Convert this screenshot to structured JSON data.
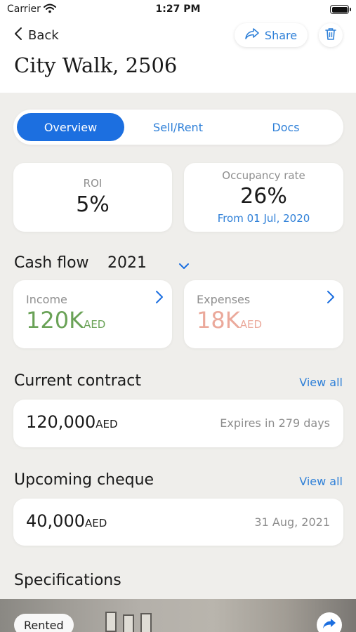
{
  "status_bar": {
    "carrier": "Carrier",
    "time": "1:27 PM"
  },
  "nav": {
    "back_label": "Back",
    "share_label": "Share"
  },
  "property": {
    "title": "City Walk, 2506"
  },
  "tabs": [
    {
      "label": "Overview",
      "active": true
    },
    {
      "label": "Sell/Rent",
      "active": false
    },
    {
      "label": "Docs",
      "active": false
    }
  ],
  "stats": {
    "roi": {
      "label": "ROI",
      "value": "5%"
    },
    "occupancy": {
      "label": "Occupancy rate",
      "value": "26%",
      "since": "From 01 Jul, 2020"
    }
  },
  "cash_flow": {
    "title": "Cash flow",
    "year": "2021",
    "income": {
      "label": "Income",
      "value": "120K",
      "unit": "AED"
    },
    "expenses": {
      "label": "Expenses",
      "value": "18K",
      "unit": "AED"
    }
  },
  "current_contract": {
    "title": "Current contract",
    "view_all": "View all",
    "amount": "120,000",
    "unit": "AED",
    "expiry": "Expires in 279 days"
  },
  "upcoming_cheque": {
    "title": "Upcoming cheque",
    "view_all": "View all",
    "amount": "40,000",
    "unit": "AED",
    "date": "31 Aug, 2021"
  },
  "specifications": {
    "title": "Specifications",
    "badge": "Rented"
  },
  "colors": {
    "accent": "#1c6fe0",
    "link": "#2f80d8",
    "income": "#6aa257",
    "expenses": "#eba99b",
    "background": "#efeeeb"
  },
  "icons": [
    "back-chevron-icon",
    "share-icon",
    "trash-icon",
    "chevron-down-icon",
    "chevron-right-icon",
    "wifi-icon",
    "battery-icon"
  ]
}
